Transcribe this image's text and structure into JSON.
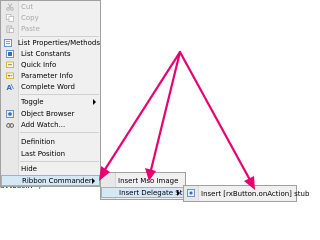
{
  "code": {
    "line": "allback:\")"
  },
  "context_menu": {
    "items": [
      {
        "label": "Cut",
        "icon": "scissors-icon",
        "disabled": true
      },
      {
        "label": "Copy",
        "icon": "copy-icon",
        "disabled": true
      },
      {
        "label": "Paste",
        "icon": "paste-icon",
        "disabled": true
      },
      {
        "label": "List Properties/Methods",
        "icon": "list-properties-icon",
        "disabled": false
      },
      {
        "label": "List Constants",
        "icon": "list-constants-icon",
        "disabled": false
      },
      {
        "label": "Quick Info",
        "icon": "quick-info-icon",
        "disabled": false
      },
      {
        "label": "Parameter Info",
        "icon": "parameter-info-icon",
        "disabled": false
      },
      {
        "label": "Complete Word",
        "icon": "complete-word-icon",
        "disabled": false
      },
      {
        "label": "Toggle",
        "icon": "",
        "disabled": false,
        "submenu": true
      },
      {
        "label": "Object Browser",
        "icon": "object-browser-icon",
        "disabled": false
      },
      {
        "label": "Add Watch...",
        "icon": "add-watch-icon",
        "disabled": false
      },
      {
        "label": "Definition",
        "icon": "",
        "disabled": false
      },
      {
        "label": "Last Position",
        "icon": "",
        "disabled": false
      },
      {
        "label": "Hide",
        "icon": "",
        "disabled": false
      },
      {
        "label": "Ribbon Commander",
        "icon": "",
        "disabled": false,
        "submenu": true,
        "active": true
      }
    ]
  },
  "ribbon_submenu": {
    "items": [
      {
        "label": "Insert Mso Image",
        "submenu": false
      },
      {
        "label": "Insert Delegate Stubs",
        "submenu": true,
        "active": true
      }
    ]
  },
  "delegate_submenu": {
    "items": [
      {
        "label": "Insert [rxButton.onAction] stub",
        "icon": "stub-icon"
      }
    ]
  },
  "colors": {
    "arrow": "#e8006f",
    "highlight": "#d5e8f8",
    "highlight_border": "#8db4e2"
  }
}
